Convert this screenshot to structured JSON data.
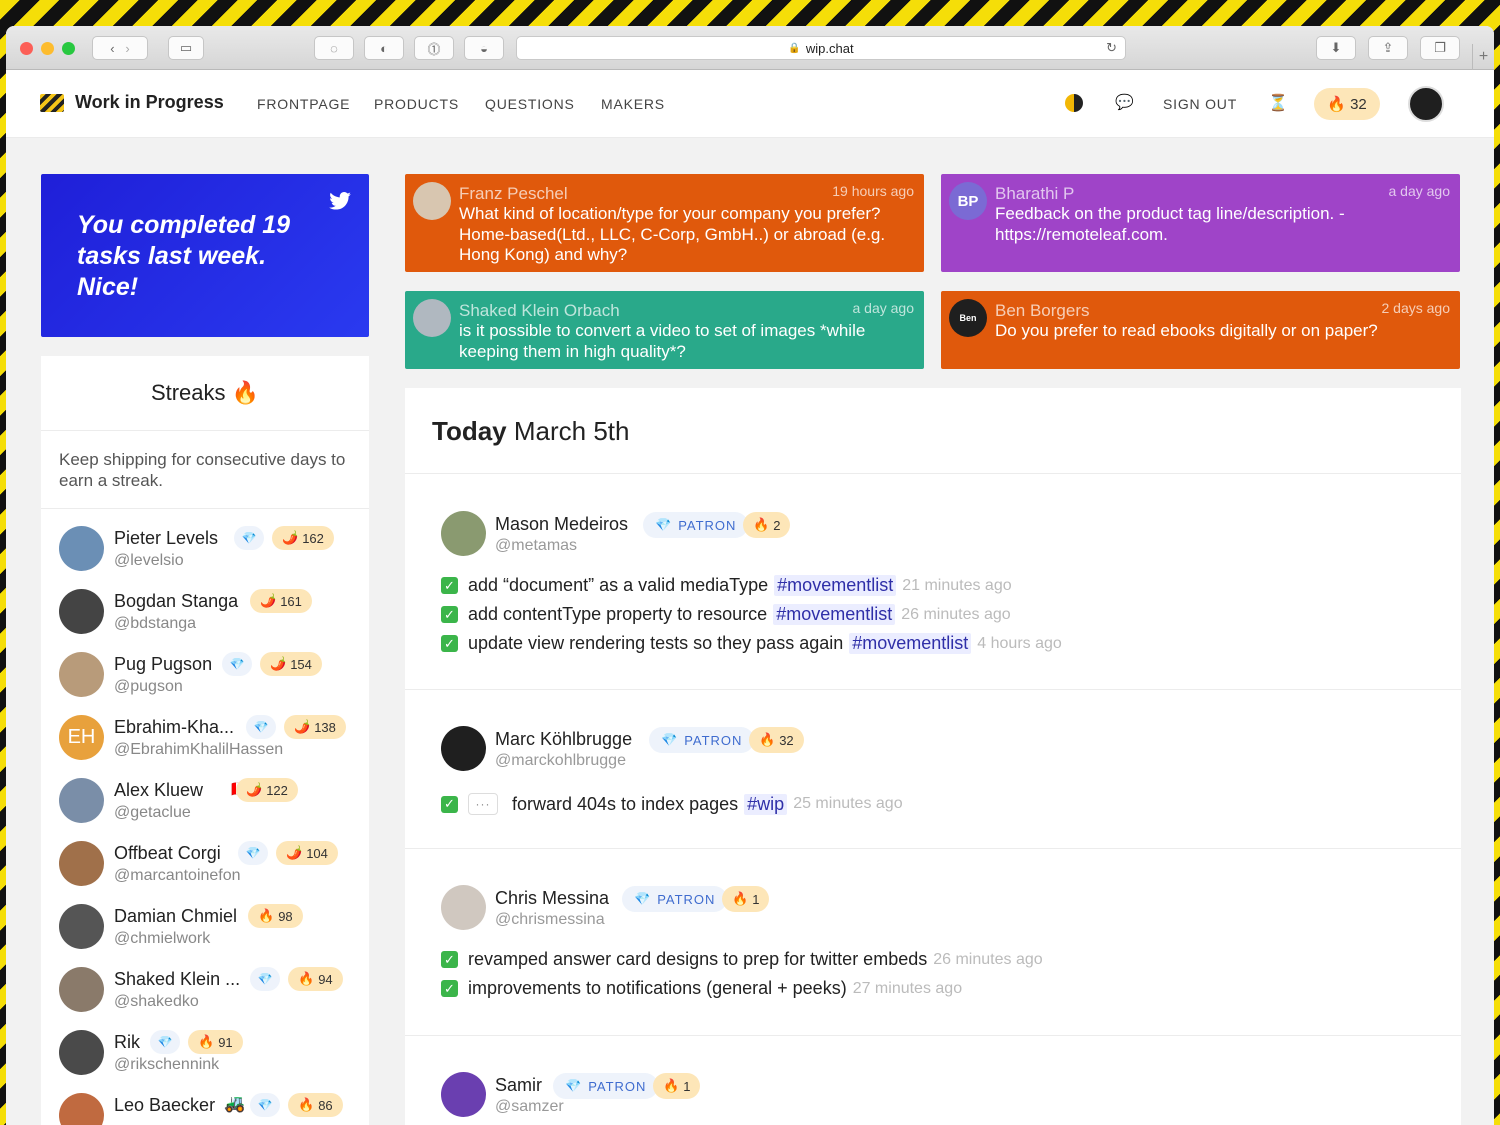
{
  "browser": {
    "url": "wip.chat"
  },
  "nav": {
    "brand": "Work in Progress",
    "links": [
      "FRONTPAGE",
      "PRODUCTS",
      "QUESTIONS",
      "MAKERS"
    ],
    "sign_out": "SIGN OUT",
    "streak_count": "32"
  },
  "twitter_card": {
    "message": "You completed 19 tasks last week. Nice!"
  },
  "streaks": {
    "title": "Streaks",
    "description": "Keep shipping for consecutive days to earn a streak.",
    "makers": [
      {
        "name": "Pieter Levels",
        "handle": "@levelsio",
        "count": "162",
        "patron": true,
        "icon": "chili"
      },
      {
        "name": "Bogdan Stanga",
        "handle": "@bdstanga",
        "count": "161",
        "patron": false,
        "icon": "chili"
      },
      {
        "name": "Pug Pugson",
        "handle": "@pugson",
        "count": "154",
        "patron": true,
        "icon": "chili"
      },
      {
        "name": "Ebrahim-Kha...",
        "handle": "@EbrahimKhalilHassen",
        "count": "138",
        "patron": true,
        "icon": "chili",
        "initials": "EH"
      },
      {
        "name": "Alex Kluew",
        "handle": "@getaclue",
        "count": "122",
        "patron": false,
        "icon": "chili"
      },
      {
        "name": "Offbeat Corgi",
        "handle": "@marcantoinefon",
        "count": "104",
        "patron": true,
        "icon": "chili"
      },
      {
        "name": "Damian Chmiel",
        "handle": "@chmielwork",
        "count": "98",
        "patron": false,
        "icon": "fire"
      },
      {
        "name": "Shaked Klein ...",
        "handle": "@shakedko",
        "count": "94",
        "patron": true,
        "icon": "fire"
      },
      {
        "name": "Rik",
        "handle": "@rikschennink",
        "count": "91",
        "patron": true,
        "icon": "fire"
      },
      {
        "name": "Leo Baecker",
        "handle": "",
        "count": "86",
        "patron": true,
        "icon": "fire"
      }
    ]
  },
  "questions": [
    {
      "name": "Franz Peschel",
      "time": "19 hours ago",
      "text": "What kind of location/type for your company you prefer? Home-based(Ltd., LLC, C-Corp, GmbH..) or abroad (e.g. Hong Kong) and why?",
      "color": "#e0590c"
    },
    {
      "name": "Bharathi P",
      "time": "a day ago",
      "text": "Feedback on the product tag line/description. - https://remoteleaf.com.",
      "color": "#9f44c8",
      "initials": "BP"
    },
    {
      "name": "Shaked Klein Orbach",
      "time": "a day ago",
      "text": "is it possible to convert a video to set of images *while keeping them in high quality*?",
      "color": "#29a98a"
    },
    {
      "name": "Ben Borgers",
      "time": "2 days ago",
      "text": "Do you prefer to read ebooks digitally or on paper?",
      "color": "#e0590c",
      "initials": "Ben"
    }
  ],
  "feed": {
    "today_label": "Today",
    "date": "March 5th",
    "patron_label": "PATRON",
    "entries": [
      {
        "name": "Mason Medeiros",
        "handle": "@metamas",
        "streak": "2",
        "tasks": [
          {
            "text": "add “document” as a valid mediaType",
            "tag": "#movementlist",
            "time": "21 minutes ago"
          },
          {
            "text": "add contentType property to resource",
            "tag": "#movementlist",
            "time": "26 minutes ago"
          },
          {
            "text": "update view rendering tests so they pass again",
            "tag": "#movementlist",
            "time": "4 hours ago"
          }
        ]
      },
      {
        "name": "Marc Köhlbrugge",
        "handle": "@marckohlbrugge",
        "streak": "32",
        "tasks": [
          {
            "text": "forward 404s to index pages",
            "tag": "#wip",
            "time": "25 minutes ago"
          }
        ]
      },
      {
        "name": "Chris Messina",
        "handle": "@chrismessina",
        "streak": "1",
        "tasks": [
          {
            "text": "revamped answer card designs to prep for twitter embeds",
            "tag": "",
            "time": "26 minutes ago"
          },
          {
            "text": "improvements to notifications (general + peeks)",
            "tag": "",
            "time": "27 minutes ago"
          }
        ]
      },
      {
        "name": "Samir",
        "handle": "@samzer",
        "streak": "1",
        "tasks": []
      }
    ]
  },
  "colors": {
    "accent_blue": "#1f1fd8",
    "orange": "#e0590c",
    "purple": "#9f44c8",
    "teal": "#29a98a",
    "streak_bg": "#fde6b8"
  }
}
